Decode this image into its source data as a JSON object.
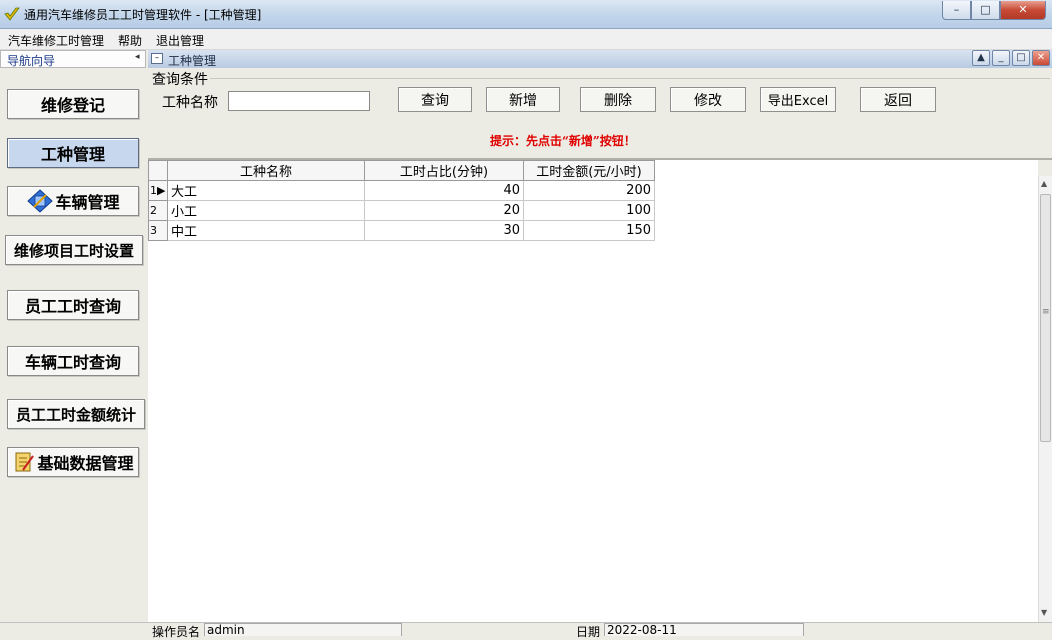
{
  "window": {
    "title": "通用汽车维修员工工时管理软件    - [工种管理]",
    "controls": {
      "minimize": "–",
      "maximize": "□",
      "close": "✕"
    }
  },
  "menu": [
    "汽车维修工时管理",
    "帮助",
    "退出管理"
  ],
  "nav": {
    "header": "导航向导",
    "collapse": "◂",
    "items": [
      {
        "label": "维修登记",
        "icon": ""
      },
      {
        "label": "工种管理",
        "icon": ""
      },
      {
        "label": "车辆管理",
        "icon": "blue-diamond-icon"
      },
      {
        "label": "维修项目工时设置",
        "icon": ""
      },
      {
        "label": "员工工时查询",
        "icon": ""
      },
      {
        "label": "车辆工时查询",
        "icon": ""
      },
      {
        "label": "员工工时金额统计",
        "icon": ""
      },
      {
        "label": "基础数据管理",
        "icon": "notes-icon"
      }
    ],
    "active_index": 1
  },
  "child": {
    "title": "工种管理",
    "controls": {
      "restore": "▲",
      "minimize": "_",
      "maximize": "□",
      "close": "✕"
    }
  },
  "query": {
    "group_title": "查询条件",
    "name_label": "工种名称",
    "name_value": "",
    "buttons": {
      "query": "查询",
      "add": "新增",
      "delete": "删除",
      "edit": "修改",
      "export": "导出Excel",
      "back": "返回"
    },
    "hint": "提示：先点击“新增”按钮！"
  },
  "grid": {
    "columns": [
      "工种名称",
      "工时占比(分钟)",
      "工时金额(元/小时)"
    ],
    "rows": [
      {
        "index": "1",
        "indicator": "▶",
        "name": "大工",
        "minutes": "40",
        "amount": "200"
      },
      {
        "index": "2",
        "indicator": "",
        "name": "小工",
        "minutes": "20",
        "amount": "100"
      },
      {
        "index": "3",
        "indicator": "",
        "name": "中工",
        "minutes": "30",
        "amount": "150"
      }
    ]
  },
  "scrollbar": {
    "up": "▲",
    "down": "▼",
    "grip": "≡"
  },
  "status": {
    "operator_label": "操作员名",
    "operator_value": "admin",
    "date_label": "日期",
    "date_value": "2022-08-11"
  },
  "colors": {
    "hint": "#e00000",
    "active_nav": "#c6d7ee",
    "title_bar": "#c2d5ea"
  }
}
